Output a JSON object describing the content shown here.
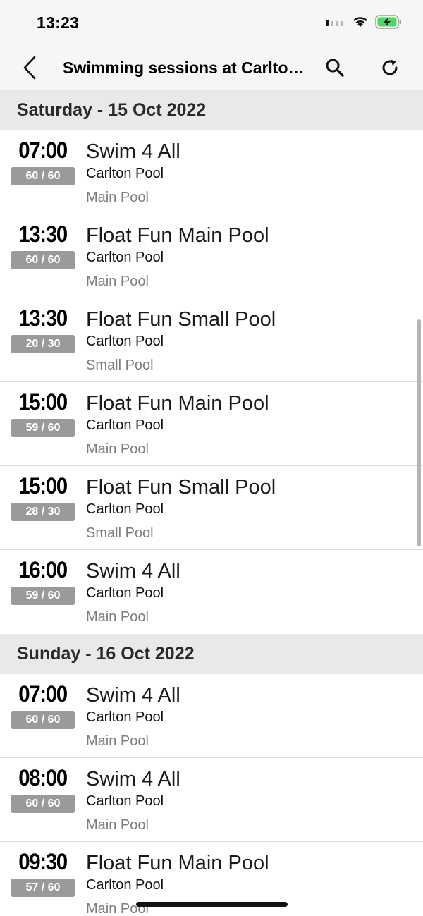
{
  "status_bar": {
    "time": "13:23"
  },
  "nav": {
    "title": "Swimming sessions at Carlton Pool"
  },
  "days": [
    {
      "header": "Saturday - 15 Oct 2022",
      "sessions": [
        {
          "time": "07:00",
          "capacity": "60 / 60",
          "title": "Swim 4 All",
          "venue": "Carlton Pool",
          "room": "Main Pool"
        },
        {
          "time": "13:30",
          "capacity": "60 / 60",
          "title": "Float Fun Main Pool",
          "venue": "Carlton Pool",
          "room": "Main Pool"
        },
        {
          "time": "13:30",
          "capacity": "20 / 30",
          "title": "Float Fun Small Pool",
          "venue": "Carlton Pool",
          "room": "Small Pool"
        },
        {
          "time": "15:00",
          "capacity": "59 / 60",
          "title": "Float Fun Main Pool",
          "venue": "Carlton Pool",
          "room": "Main Pool"
        },
        {
          "time": "15:00",
          "capacity": "28 / 30",
          "title": "Float Fun Small Pool",
          "venue": "Carlton Pool",
          "room": "Small Pool"
        },
        {
          "time": "16:00",
          "capacity": "59 / 60",
          "title": "Swim 4 All",
          "venue": "Carlton Pool",
          "room": "Main Pool"
        }
      ]
    },
    {
      "header": "Sunday - 16 Oct 2022",
      "sessions": [
        {
          "time": "07:00",
          "capacity": "60 / 60",
          "title": "Swim 4 All",
          "venue": "Carlton Pool",
          "room": "Main Pool"
        },
        {
          "time": "08:00",
          "capacity": "60 / 60",
          "title": "Swim 4 All",
          "venue": "Carlton Pool",
          "room": "Main Pool"
        },
        {
          "time": "09:30",
          "capacity": "57 / 60",
          "title": "Float Fun Main Pool",
          "venue": "Carlton Pool",
          "room": "Main Pool"
        }
      ]
    }
  ],
  "icons": {
    "back": "chevron-left-icon",
    "search": "search-icon",
    "refresh": "refresh-icon",
    "signal": "cellular-signal-icon",
    "wifi": "wifi-icon",
    "battery": "battery-charging-icon"
  },
  "colors": {
    "battery_fill": "#4cd964",
    "badge_bg": "#9a9a9a",
    "day_header_bg": "#e9e9ea"
  }
}
